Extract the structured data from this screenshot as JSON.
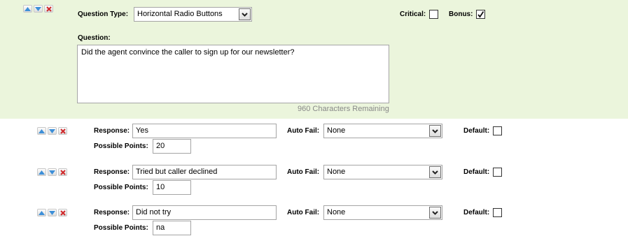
{
  "question": {
    "type_label": "Question Type:",
    "type_value": "Horizontal Radio Buttons",
    "critical_label": "Critical:",
    "critical_checked": false,
    "bonus_label": "Bonus:",
    "bonus_checked": true,
    "question_label": "Question:",
    "question_text": "Did the agent convince the caller to sign up for our newsletter?",
    "chars_remaining": "960 Characters Remaining"
  },
  "labels": {
    "response": "Response:",
    "auto_fail": "Auto Fail:",
    "default": "Default:",
    "possible_points": "Possible Points:"
  },
  "responses": [
    {
      "response": "Yes",
      "auto_fail": "None",
      "default_checked": false,
      "points": "20"
    },
    {
      "response": "Tried but caller declined",
      "auto_fail": "None",
      "default_checked": false,
      "points": "10"
    },
    {
      "response": "Did not try",
      "auto_fail": "None",
      "default_checked": false,
      "points": "na"
    }
  ],
  "icons": {
    "move_up": "arrow-up-icon",
    "move_down": "arrow-down-icon",
    "delete": "delete-x-icon"
  },
  "colors": {
    "question_bg": "#ebf5dc",
    "arrow_blue": "#3d8fd8",
    "delete_red": "#d0282a"
  }
}
